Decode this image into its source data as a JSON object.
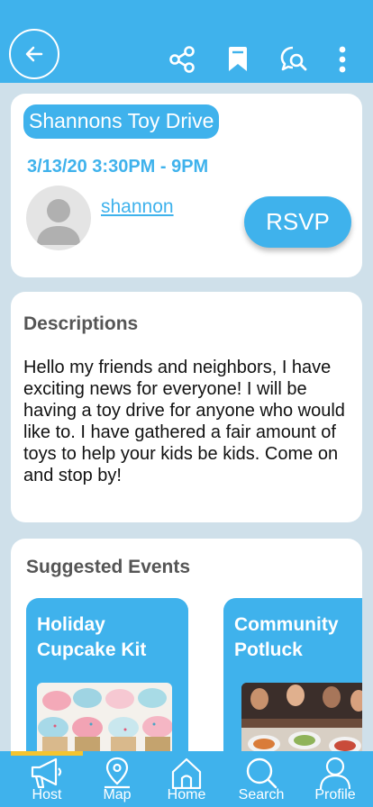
{
  "header": {
    "back_icon": "arrow-left-icon",
    "actions": [
      "share-icon",
      "bookmark-icon",
      "chat-search-icon",
      "more-vertical-icon"
    ]
  },
  "event": {
    "title": "Shannons Toy Drive",
    "datetime": "3/13/20 3:30PM - 9PM",
    "host_name": "shannon",
    "rsvp_label": "RSVP"
  },
  "description": {
    "heading": "Descriptions",
    "text": "Hello my friends and neighbors, I have exciting news for everyone! I will be having a toy drive for anyone who would like to. I have gathered a fair amount of toys to help your kids be kids. Come on and stop by!"
  },
  "suggested": {
    "heading": "Suggested Events",
    "events": [
      {
        "title": "Holiday Cupcake Kit"
      },
      {
        "title": "Community Potluck"
      }
    ]
  },
  "nav": {
    "items": [
      {
        "label": "Host",
        "icon": "megaphone-icon"
      },
      {
        "label": "Map",
        "icon": "map-pin-icon"
      },
      {
        "label": "Home",
        "icon": "home-icon"
      },
      {
        "label": "Search",
        "icon": "search-icon"
      },
      {
        "label": "Profile",
        "icon": "user-icon"
      }
    ],
    "active": "Host"
  },
  "colors": {
    "primary": "#3fb2ec",
    "background": "#cfe0ea",
    "active_indicator": "#f4c430"
  }
}
